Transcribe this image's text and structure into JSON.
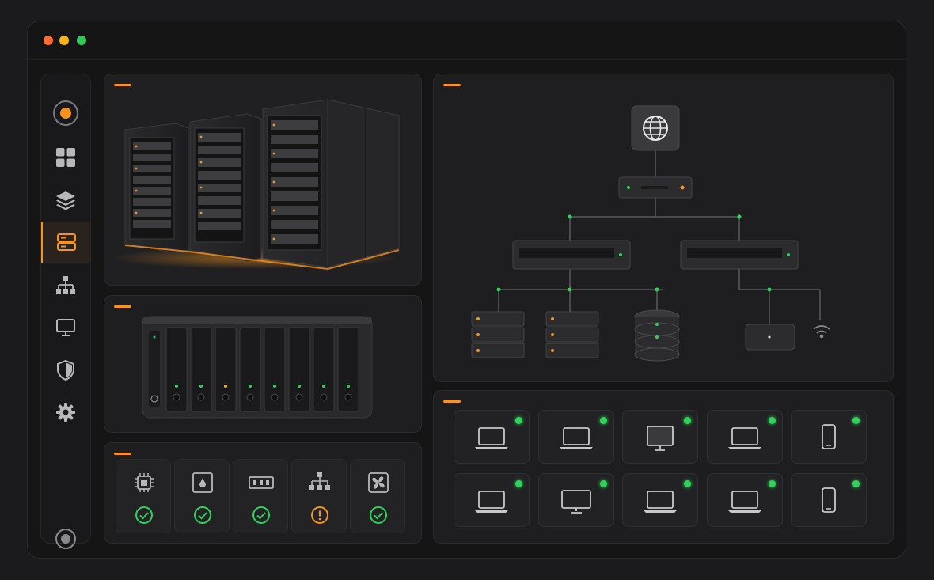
{
  "window": {
    "controls": [
      {
        "name": "close",
        "color": "#ff5f57"
      },
      {
        "name": "minimize",
        "color": "#febc2e"
      },
      {
        "name": "zoom",
        "color": "#28c840"
      }
    ]
  },
  "sidebar": {
    "items": [
      {
        "icon": "logo-ring-icon",
        "active": false
      },
      {
        "icon": "dashboard-grid-icon",
        "active": false
      },
      {
        "icon": "layers-icon",
        "active": false
      },
      {
        "icon": "server-stack-icon",
        "active": true
      },
      {
        "icon": "network-topology-icon",
        "active": false
      },
      {
        "icon": "monitor-icon",
        "active": false
      },
      {
        "icon": "shield-icon",
        "active": false
      },
      {
        "icon": "gear-icon",
        "active": false
      }
    ],
    "footer_icon": "user-ring-icon"
  },
  "panels": {
    "server_racks": {
      "image": "server-racks-image"
    },
    "nas": {
      "image": "nas-storage-image",
      "bays": 8,
      "bay_led_colors": [
        "#2fd35a",
        "#2fd35a",
        "#f7b21e",
        "#2fd35a",
        "#2fd35a",
        "#2fd35a",
        "#2fd35a",
        "#2fd35a"
      ]
    },
    "health": {
      "items": [
        {
          "icon": "cpu-icon",
          "status": "ok"
        },
        {
          "icon": "disk-icon",
          "status": "ok"
        },
        {
          "icon": "memory-icon",
          "status": "ok"
        },
        {
          "icon": "network-icon",
          "status": "warning"
        },
        {
          "icon": "fan-icon",
          "status": "ok"
        }
      ]
    },
    "topology": {
      "nodes": [
        "internet-globe-icon",
        "router-icon",
        "switch-icon",
        "switch-icon",
        "server-icon",
        "server-icon",
        "database-icon",
        "access-point-icon",
        "wifi-icon"
      ]
    },
    "devices": {
      "items": [
        {
          "icon": "laptop-icon",
          "online": true
        },
        {
          "icon": "laptop-icon",
          "online": true
        },
        {
          "icon": "tablet-screen-icon",
          "online": true
        },
        {
          "icon": "laptop-icon",
          "online": true
        },
        {
          "icon": "phone-icon",
          "online": true
        },
        {
          "icon": "laptop-icon",
          "online": true
        },
        {
          "icon": "monitor-icon",
          "online": true
        },
        {
          "icon": "laptop-icon",
          "online": true
        },
        {
          "icon": "laptop-icon",
          "online": true
        },
        {
          "icon": "phone-icon",
          "online": true
        }
      ]
    }
  },
  "colors": {
    "accent": "#f7931e",
    "ok": "#2fd35a",
    "warning": "#f7931e"
  }
}
